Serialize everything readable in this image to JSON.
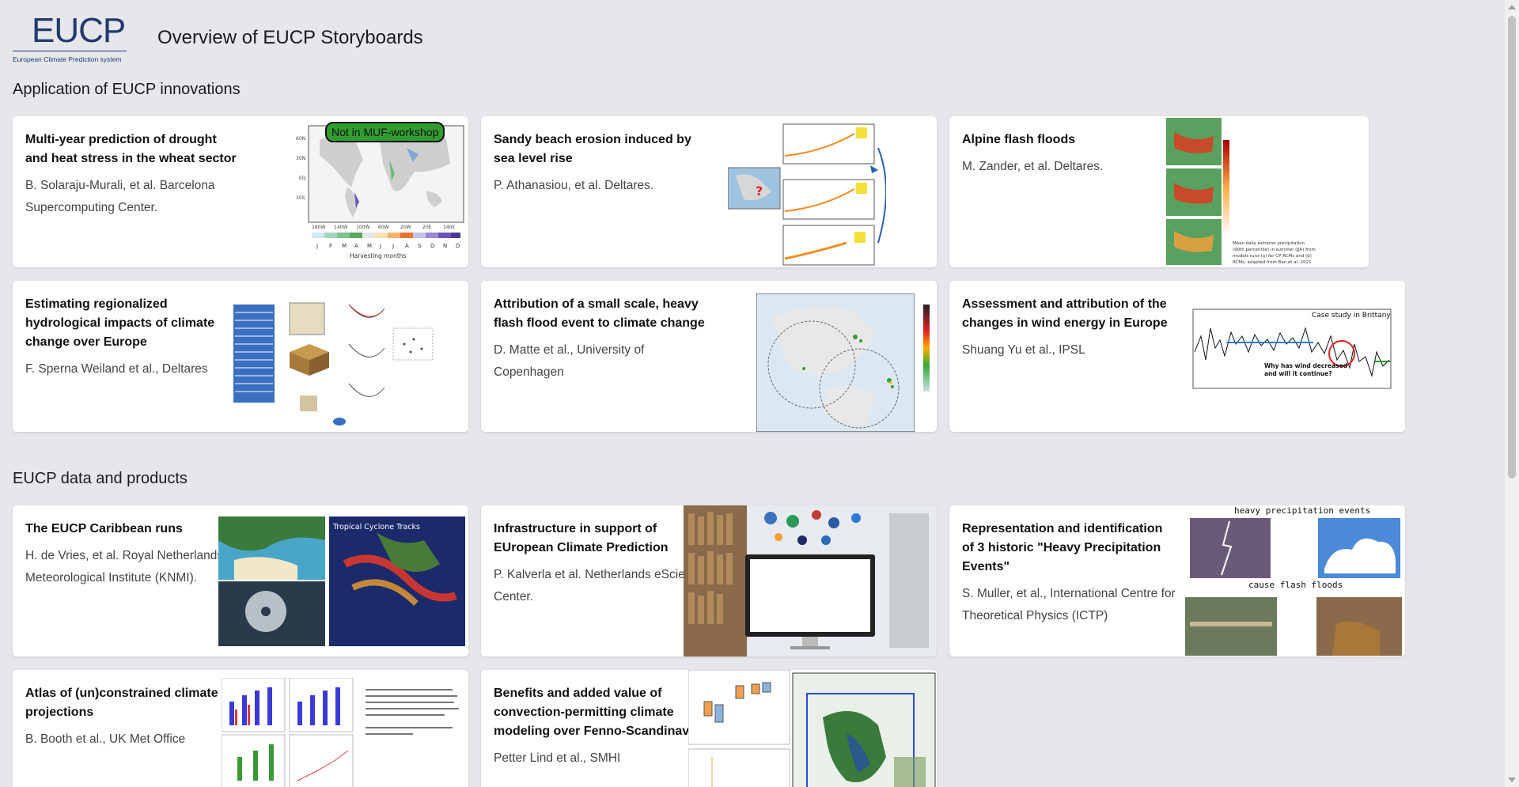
{
  "header": {
    "logo_text": "EUCP",
    "logo_subtitle": "European Climate Prediction system",
    "title": "Overview of EUCP Storyboards"
  },
  "sections": [
    {
      "heading": "Application of EUCP innovations",
      "cards": [
        {
          "title": "Multi-year prediction of drought and heat stress in the wheat sector",
          "authors": "B. Solaraju-Murali, et al. Barcelona Supercomputing Center.",
          "badge": "Not in MUF-workshop",
          "thumb_labels": [
            "J",
            "F",
            "M",
            "A",
            "M",
            "J",
            "J",
            "A",
            "S",
            "O",
            "N",
            "D"
          ],
          "thumb_caption": "Harvesting months"
        },
        {
          "title": "Sandy beach erosion induced by sea level rise",
          "authors": "P. Athanasiou, et al. Deltares."
        },
        {
          "title": "Alpine flash floods",
          "authors": "M. Zander, et al. Deltares."
        },
        {
          "title": "Estimating regionalized hydrological impacts of climate change over Europe",
          "authors": "F. Sperna Weiland et al., Deltares"
        },
        {
          "title": "Attribution of a small scale, heavy flash flood event to climate change",
          "authors": "D. Matte et al., University of Copenhagen"
        },
        {
          "title": "Assessment and attribution of the changes in wind energy in Europe",
          "authors": "Shuang Yu et al., IPSL",
          "thumb_labels": [
            "Case study in Brittany",
            "Why has wind decreased",
            "and will it continue?"
          ]
        }
      ]
    },
    {
      "heading": "EUCP data and products",
      "cards": [
        {
          "title": "The EUCP Caribbean runs",
          "authors": "H. de Vries, et al. Royal Netherlands Meteorological Institute (KNMI).",
          "thumb_labels": [
            "Tropical Cyclone Tracks"
          ]
        },
        {
          "title": "Infrastructure in support of EUropean Climate Prediction",
          "authors": "P. Kalverla et al. Netherlands eScience Center."
        },
        {
          "title": "Representation and identification of 3 historic \"Heavy Precipitation Events\"",
          "authors": "S. Muller, et al., International Centre for Theoretical Physics (ICTP)",
          "thumb_labels": [
            "heavy precipitation events",
            "cause flash floods"
          ]
        },
        {
          "title": "Atlas of (un)constrained climate projections",
          "authors": "B. Booth et al., UK Met Office"
        },
        {
          "title": "Benefits and added value of convection-permitting climate modeling over Fenno-Scandinavia",
          "authors": "Petter Lind et al., SMHI"
        }
      ]
    }
  ],
  "colors": {
    "background": "#e6e7eb",
    "card": "#ffffff",
    "badge": "#2f9e2f",
    "logo": "#233a6e"
  }
}
